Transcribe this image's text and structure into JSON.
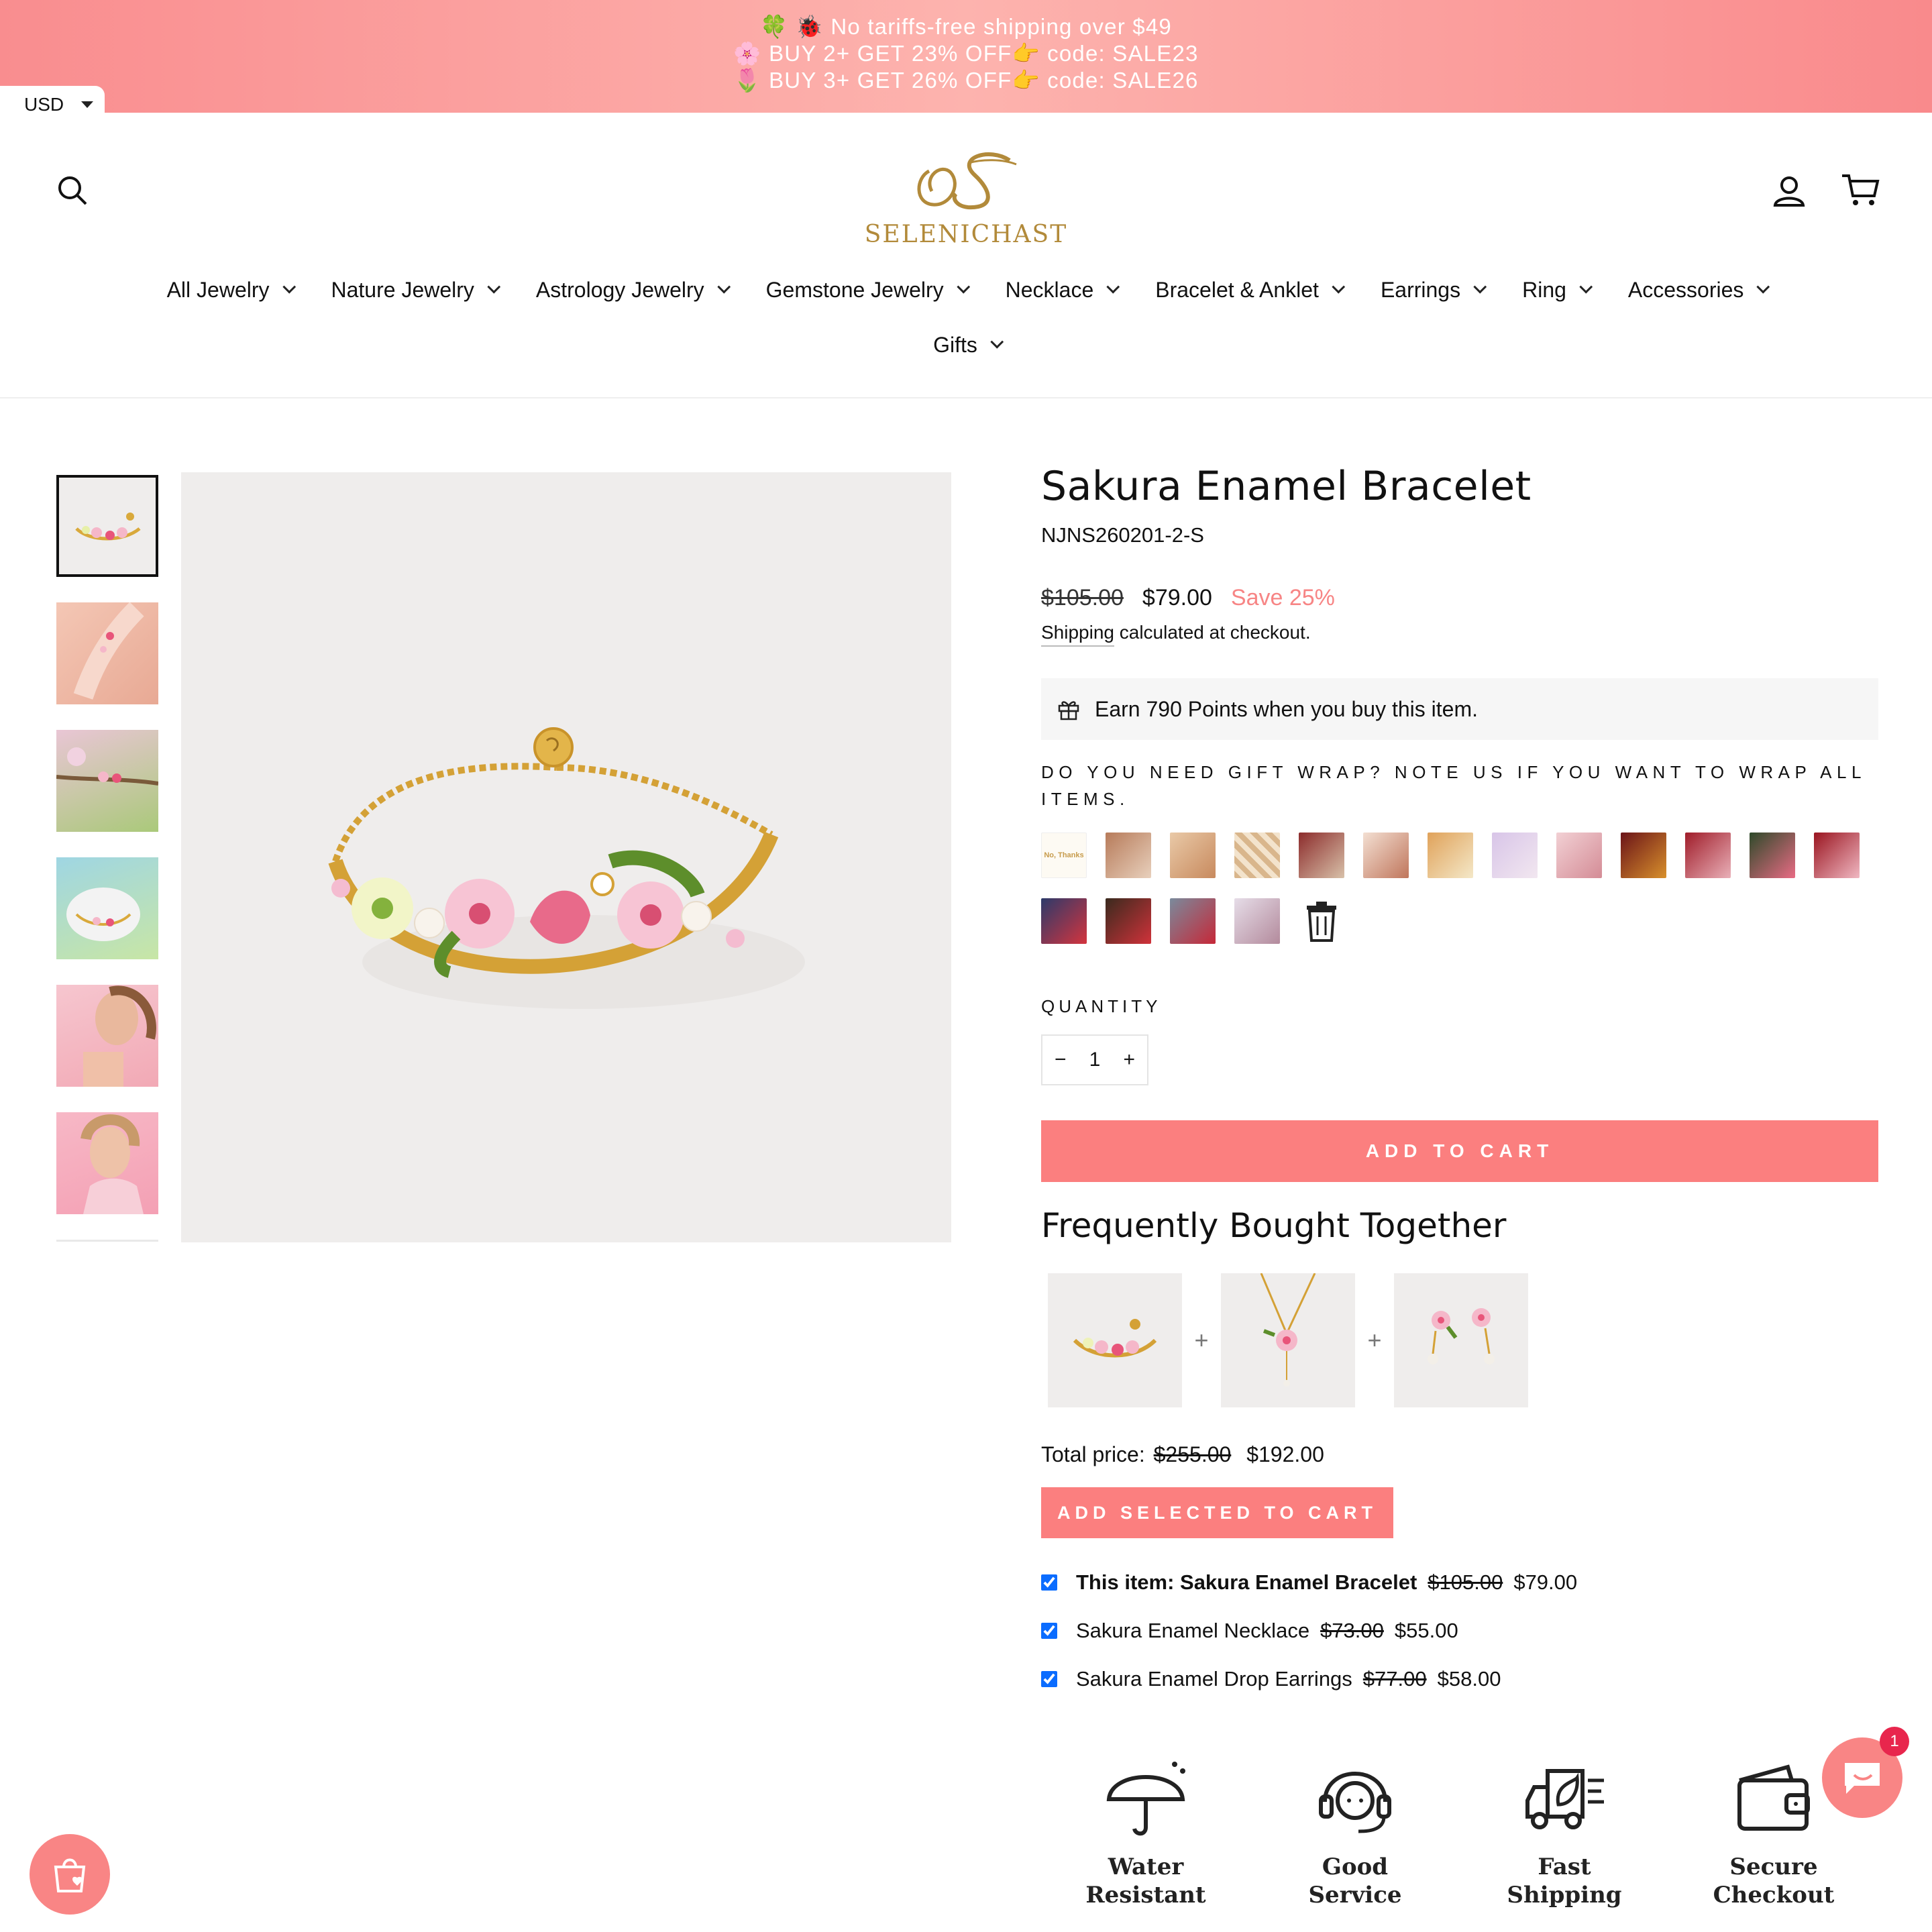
{
  "announcement": {
    "line1": "🍀 🐞 No tariffs-free shipping over $49",
    "line2": "🌸 BUY 2+ GET 23% OFF👉 code: SALE23",
    "line3": "🌷 BUY 3+ GET 26% OFF👉 code: SALE26",
    "colors": [
      "#f98d8f",
      "#fdb3ae"
    ]
  },
  "currency": {
    "value": "USD"
  },
  "header": {
    "logo_text": "SELENICHAST",
    "icons": [
      "search-icon",
      "account-icon",
      "cart-icon"
    ]
  },
  "nav": {
    "items": [
      {
        "label": "All Jewelry"
      },
      {
        "label": "Nature Jewelry"
      },
      {
        "label": "Astrology Jewelry"
      },
      {
        "label": "Gemstone Jewelry"
      },
      {
        "label": "Necklace"
      },
      {
        "label": "Bracelet & Anklet"
      },
      {
        "label": "Earrings"
      },
      {
        "label": "Ring"
      },
      {
        "label": "Accessories"
      },
      {
        "label": "Gifts"
      }
    ]
  },
  "product": {
    "title": "Sakura Enamel Bracelet",
    "sku": "NJNS260201-2-S",
    "price_old": "$105.00",
    "price_new": "$79.00",
    "save": "Save 25%",
    "shipping_link": "Shipping",
    "shipping_rest": " calculated at checkout.",
    "points": "Earn 790 Points when you buy this item.",
    "gift_wrap_label": "DO YOU NEED GIFT WRAP? NOTE US IF YOU WANT TO WRAP ALL ITEMS.",
    "gift_wrap_first": "No, Thanks",
    "quantity_label": "QUANTITY",
    "quantity": "1",
    "qty_minus": "−",
    "qty_plus": "+",
    "add_to_cart": "ADD TO CART"
  },
  "fbt": {
    "title": "Frequently Bought Together",
    "plus": "+",
    "total_label": "Total price:",
    "total_old": "$255.00",
    "total_new": "$192.00",
    "add_selected": "ADD SELECTED TO CART",
    "items": [
      {
        "name": "This item: Sakura Enamel Bracelet",
        "old": "$105.00",
        "new": "$79.00"
      },
      {
        "name": "Sakura Enamel Necklace",
        "old": "$73.00",
        "new": "$55.00"
      },
      {
        "name": "Sakura Enamel Drop Earrings",
        "old": "$77.00",
        "new": "$58.00"
      }
    ]
  },
  "features": [
    {
      "line1": "Water",
      "line2": "Resistant",
      "icon": "umbrella-icon"
    },
    {
      "line1": "Good",
      "line2": "Service",
      "icon": "headset-icon"
    },
    {
      "line1": "Fast",
      "line2": "Shipping",
      "icon": "truck-icon"
    },
    {
      "line1": "Secure",
      "line2": "Checkout",
      "icon": "wallet-icon"
    }
  ],
  "chat": {
    "badge": "1"
  },
  "accent_color": "#fb7f7f"
}
